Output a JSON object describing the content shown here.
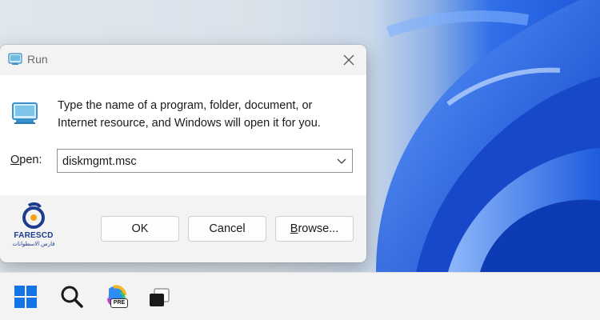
{
  "colors": {
    "wallpaper_blue": "#1e56d8",
    "dialog_bg": "#f3f3f3",
    "content_bg": "#ffffff",
    "logo_blue": "#1d3c8f",
    "windows_blue": "#0a6cd8"
  },
  "run_dialog": {
    "title": "Run",
    "title_icon": "run-icon",
    "description_line1": "Type the name of a program, folder, document, or",
    "description_line2": "Internet resource, and Windows will open it for you.",
    "open_label_mnemonic": "O",
    "open_label_rest": "pen:",
    "open_value": "diskmgmt.msc",
    "ok_label": "OK",
    "cancel_label": "Cancel",
    "browse_label_mnemonic": "B",
    "browse_label_rest": "rowse..."
  },
  "watermark": {
    "name": "FARESCD",
    "subtitle": "فارس الاسطوانات"
  },
  "taskbar": {
    "items": [
      {
        "icon": "windows-start-icon"
      },
      {
        "icon": "search-icon"
      },
      {
        "icon": "copilot-icon",
        "badge": "PRE"
      },
      {
        "icon": "task-view-icon"
      }
    ]
  }
}
